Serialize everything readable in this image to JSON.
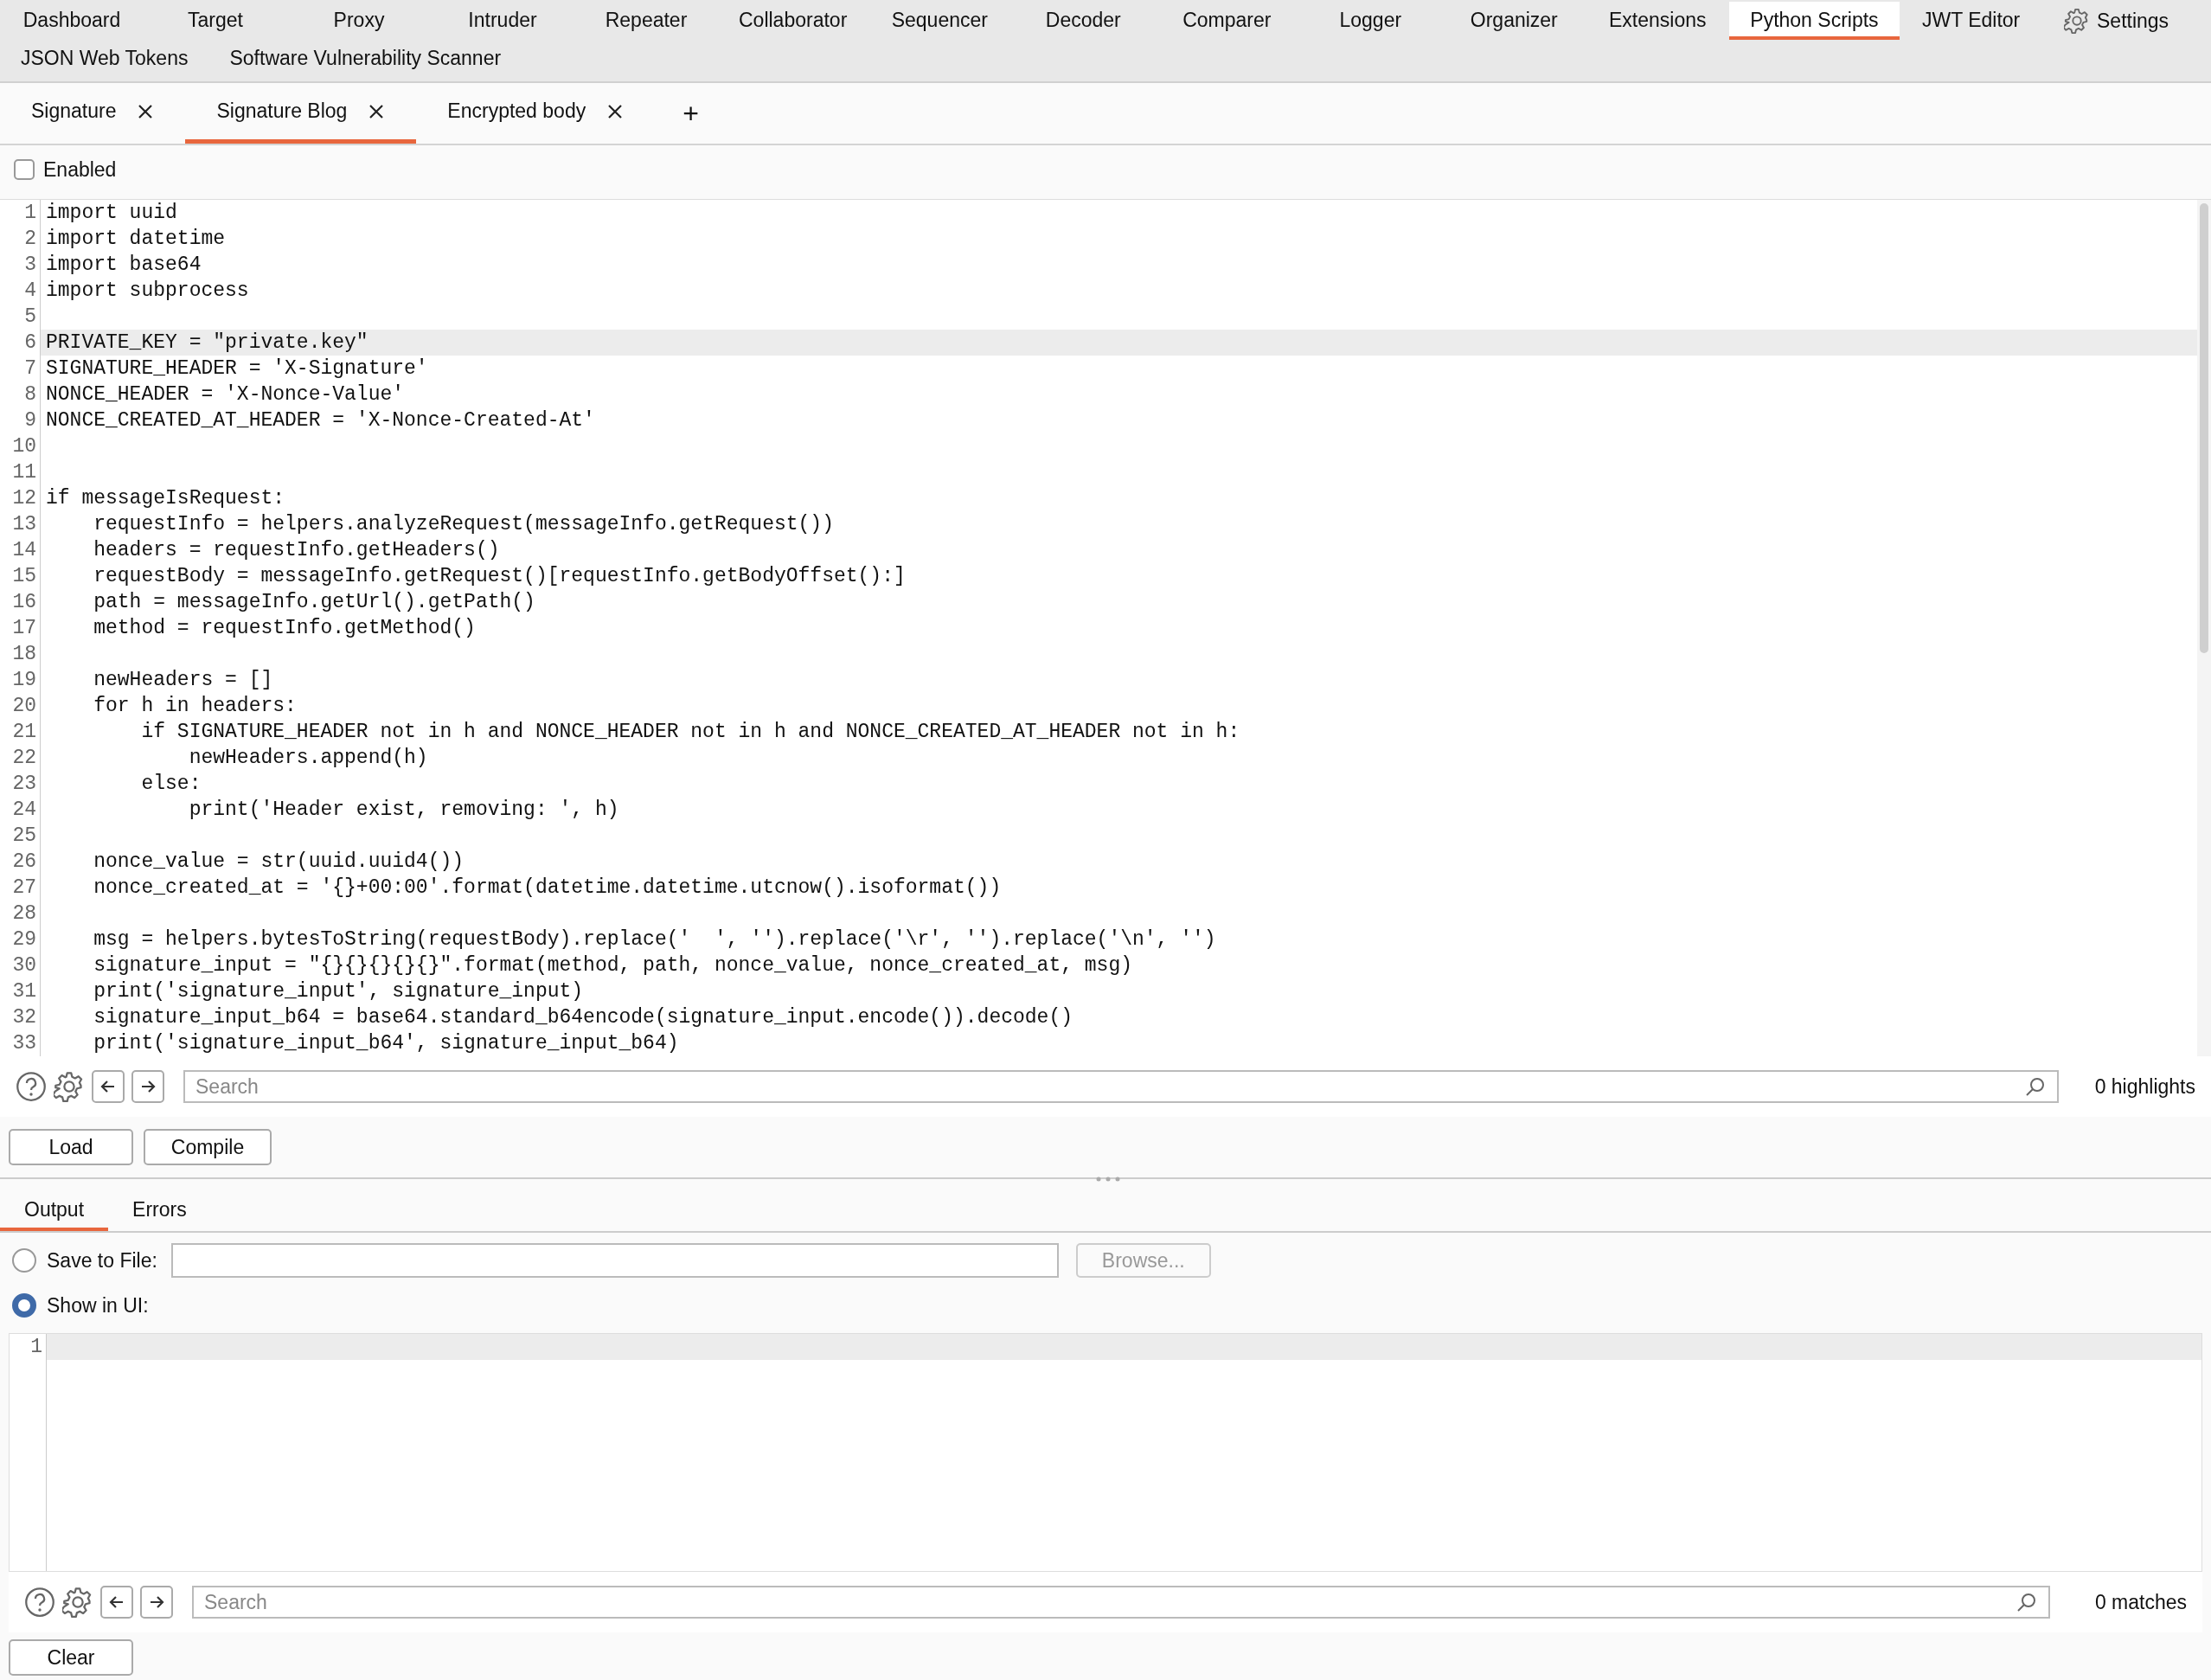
{
  "nav": {
    "tabs": [
      {
        "label": "Dashboard",
        "selected": false
      },
      {
        "label": "Target",
        "selected": false
      },
      {
        "label": "Proxy",
        "selected": false
      },
      {
        "label": "Intruder",
        "selected": false
      },
      {
        "label": "Repeater",
        "selected": false
      },
      {
        "label": "Collaborator",
        "selected": false
      },
      {
        "label": "Sequencer",
        "selected": false
      },
      {
        "label": "Decoder",
        "selected": false
      },
      {
        "label": "Comparer",
        "selected": false
      },
      {
        "label": "Logger",
        "selected": false
      },
      {
        "label": "Organizer",
        "selected": false
      },
      {
        "label": "Extensions",
        "selected": false
      },
      {
        "label": "Python Scripts",
        "selected": true
      },
      {
        "label": "JWT Editor",
        "selected": false
      },
      {
        "label": "JSON Web Tokens",
        "selected": false
      },
      {
        "label": "Software Vulnerability Scanner",
        "selected": false
      }
    ],
    "settings": "Settings"
  },
  "script_tabs": [
    {
      "label": "Signature",
      "selected": false
    },
    {
      "label": "Signature Blog",
      "selected": true
    },
    {
      "label": "Encrypted body",
      "selected": false
    }
  ],
  "add_tab": "+",
  "enabled": {
    "label": "Enabled",
    "checked": false
  },
  "editor": {
    "lines": [
      {
        "n": "1",
        "text": "import uuid",
        "current": false
      },
      {
        "n": "2",
        "text": "import datetime",
        "current": false
      },
      {
        "n": "3",
        "text": "import base64",
        "current": false
      },
      {
        "n": "4",
        "text": "import subprocess",
        "current": false
      },
      {
        "n": "5",
        "current": false
      },
      {
        "n": "6",
        "text": "PRIVATE_KEY = \"private.key\"",
        "current": true
      },
      {
        "n": "7",
        "text": "SIGNATURE_HEADER = 'X-Signature'",
        "current": false
      },
      {
        "n": "8",
        "text": "NONCE_HEADER = 'X-Nonce-Value'",
        "current": false
      },
      {
        "n": "9",
        "text": "NONCE_CREATED_AT_HEADER = 'X-Nonce-Created-At'",
        "current": false
      },
      {
        "n": "10",
        "current": false
      },
      {
        "n": "11",
        "current": false
      },
      {
        "n": "12",
        "text": "if messageIsRequest:",
        "current": false
      },
      {
        "n": "13",
        "text": "    requestInfo = helpers.analyzeRequest(messageInfo.getRequest())",
        "current": false
      },
      {
        "n": "14",
        "text": "    headers = requestInfo.getHeaders()",
        "current": false
      },
      {
        "n": "15",
        "text": "    requestBody = messageInfo.getRequest()[requestInfo.getBodyOffset():]",
        "current": false
      },
      {
        "n": "16",
        "text": "    path = messageInfo.getUrl().getPath()",
        "current": false
      },
      {
        "n": "17",
        "text": "    method = requestInfo.getMethod()",
        "current": false
      },
      {
        "n": "18",
        "current": false
      },
      {
        "n": "19",
        "text": "    newHeaders = []",
        "current": false
      },
      {
        "n": "20",
        "text": "    for h in headers:",
        "current": false
      },
      {
        "n": "21",
        "text": "        if SIGNATURE_HEADER not in h and NONCE_HEADER not in h and NONCE_CREATED_AT_HEADER not in h:",
        "current": false
      },
      {
        "n": "22",
        "text": "            newHeaders.append(h)",
        "current": false
      },
      {
        "n": "23",
        "text": "        else:",
        "current": false
      },
      {
        "n": "24",
        "text": "            print('Header exist, removing: ', h)",
        "current": false
      },
      {
        "n": "25",
        "current": false
      },
      {
        "n": "26",
        "text": "    nonce_value = str(uuid.uuid4())",
        "current": false
      },
      {
        "n": "27",
        "text": "    nonce_created_at = '{}+00:00'.format(datetime.datetime.utcnow().isoformat())",
        "current": false
      },
      {
        "n": "28",
        "current": false
      },
      {
        "n": "29",
        "text": "    msg = helpers.bytesToString(requestBody).replace('  ', '').replace('\\r', '').replace('\\n', '')",
        "current": false
      },
      {
        "n": "30",
        "text": "    signature_input = \"{}{}{}{}{}\".format(method, path, nonce_value, nonce_created_at, msg)",
        "current": false
      },
      {
        "n": "31",
        "text": "    print('signature_input', signature_input)",
        "current": false
      },
      {
        "n": "32",
        "text": "    signature_input_b64 = base64.standard_b64encode(signature_input.encode()).decode()",
        "current": false
      },
      {
        "n": "33",
        "text": "    print('signature_input_b64', signature_input_b64)",
        "current": false
      }
    ]
  },
  "editor_search": {
    "placeholder": "Search",
    "count": "0 highlights"
  },
  "buttons": [
    "Load",
    "Compile"
  ],
  "output_tabs": [
    {
      "label": "Output",
      "selected": true
    },
    {
      "label": "Errors",
      "selected": false
    }
  ],
  "save_to_file": {
    "label": "Save to File:",
    "selected": false,
    "browse": "Browse..."
  },
  "show_in_ui": {
    "label": "Show in UI:",
    "selected": true
  },
  "output_editor": {
    "lines": [
      {
        "n": "1",
        "current": true
      }
    ]
  },
  "output_search": {
    "placeholder": "Search",
    "count": "0 matches"
  },
  "clear": "Clear"
}
